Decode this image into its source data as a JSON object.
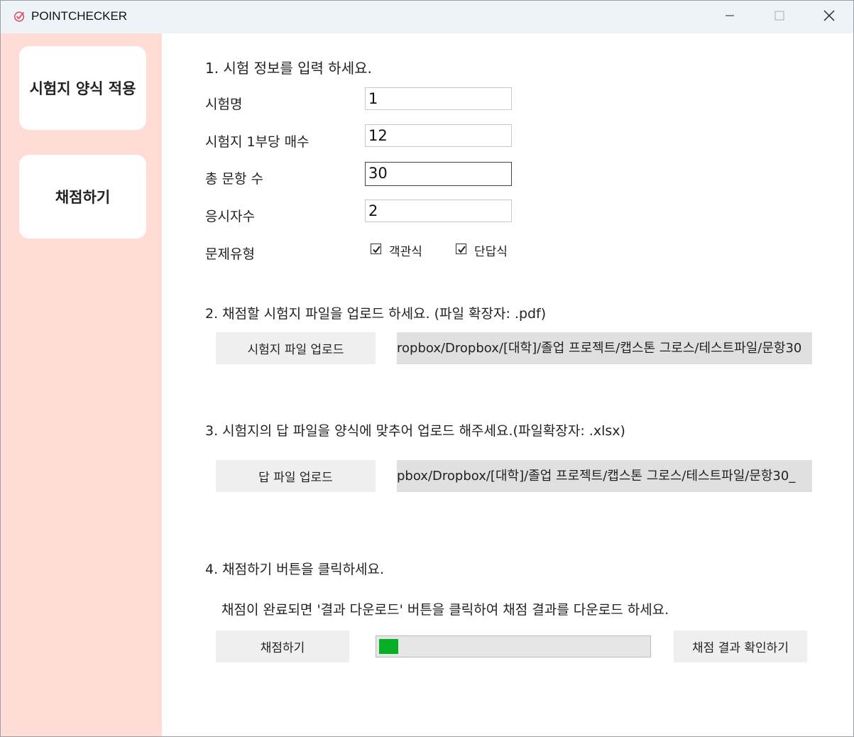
{
  "window": {
    "title": "POINTCHECKER",
    "controls": [
      "minimize-icon",
      "maximize-icon",
      "close-icon"
    ]
  },
  "sidebar": {
    "items": [
      {
        "label": "시험지 양식 적용"
      },
      {
        "label": "채점하기"
      }
    ]
  },
  "section1": {
    "heading": "1. 시험 정보를 입력 하세요.",
    "exam_name_label": "시험명",
    "exam_name_value": "1",
    "pages_label": "시험지 1부당 매수",
    "pages_value": "12",
    "questions_label": "총 문항 수",
    "questions_value": "30",
    "examinees_label": "응시자수",
    "examinees_value": "2",
    "type_label": "문제유형",
    "type_options": [
      {
        "label": "객관식",
        "checked": true
      },
      {
        "label": "단답식",
        "checked": true
      }
    ]
  },
  "section2": {
    "heading": "2. 채점할 시험지 파일을 업로드 하세요. (파일 확장자: .pdf)",
    "button": "시험지 파일 업로드",
    "path": "ropbox/Dropbox/[대학]/졸업 프로젝트/캡스톤 그로스/테스트파일/문항30"
  },
  "section3": {
    "heading": "3. 시험지의 답 파일을 양식에 맞추어 업로드 해주세요.(파일확장자: .xlsx)",
    "button": "답 파일 업로드",
    "path": "pbox/Dropbox/[대학]/졸업 프로젝트/캡스톤 그로스/테스트파일/문항30_"
  },
  "section4": {
    "heading": "4. 채점하기 버튼을 클릭하세요.",
    "note": "채점이 완료되면 '결과 다운로드' 버튼을 클릭하여 채점 결과를 다운로드 하세요.",
    "grade_button": "채점하기",
    "progress": 0.07,
    "result_button": "채점 결과 확인하기"
  },
  "colors": {
    "sidebar_bg": "#ffdcd5",
    "progress_fill": "#06b025",
    "titlebar_bg": "#eef3f8"
  }
}
